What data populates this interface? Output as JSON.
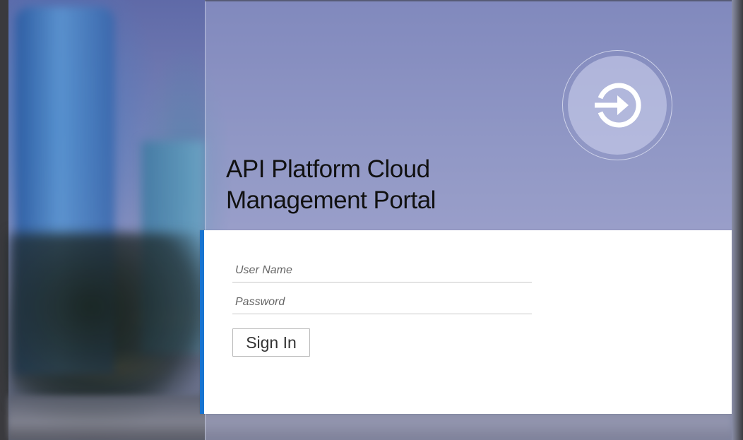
{
  "app": {
    "title": "API Platform Cloud",
    "subtitle": "Management Portal"
  },
  "login": {
    "username_placeholder": "User Name",
    "password_placeholder": "Password",
    "username_value": "",
    "password_value": "",
    "signin_label": "Sign In"
  },
  "icons": {
    "hero": "sign-in-icon"
  },
  "colors": {
    "accent": "#1874d1",
    "panel_background": "#ffffff",
    "title_text": "#111111"
  }
}
